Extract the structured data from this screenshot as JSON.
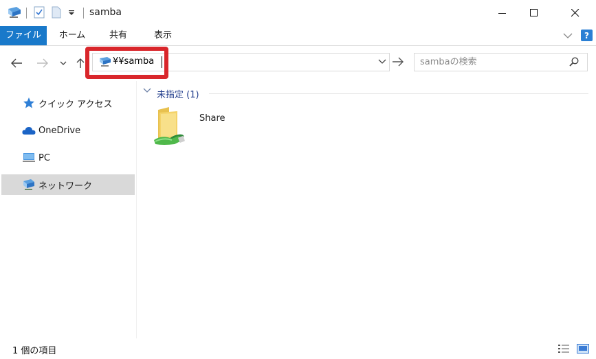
{
  "window": {
    "title": "samba"
  },
  "ribbon": {
    "tabs": [
      {
        "label": "ファイル"
      },
      {
        "label": "ホーム"
      },
      {
        "label": "共有"
      },
      {
        "label": "表示"
      }
    ]
  },
  "address": {
    "path": "¥¥samba"
  },
  "search": {
    "placeholder": "sambaの検索"
  },
  "sidebar": {
    "items": [
      {
        "label": "クイック アクセス",
        "icon": "star-icon"
      },
      {
        "label": "OneDrive",
        "icon": "cloud-icon"
      },
      {
        "label": "PC",
        "icon": "computer-icon"
      },
      {
        "label": "ネットワーク",
        "icon": "network-icon",
        "selected": true
      }
    ]
  },
  "content": {
    "group_label": "未指定 (1)",
    "items": [
      {
        "label": "Share",
        "icon": "shared-folder-icon"
      }
    ]
  },
  "status": {
    "text": "1 個の項目"
  },
  "colors": {
    "accent": "#1979ca",
    "highlight": "#d9262b",
    "selected": "#d9d9d9"
  }
}
